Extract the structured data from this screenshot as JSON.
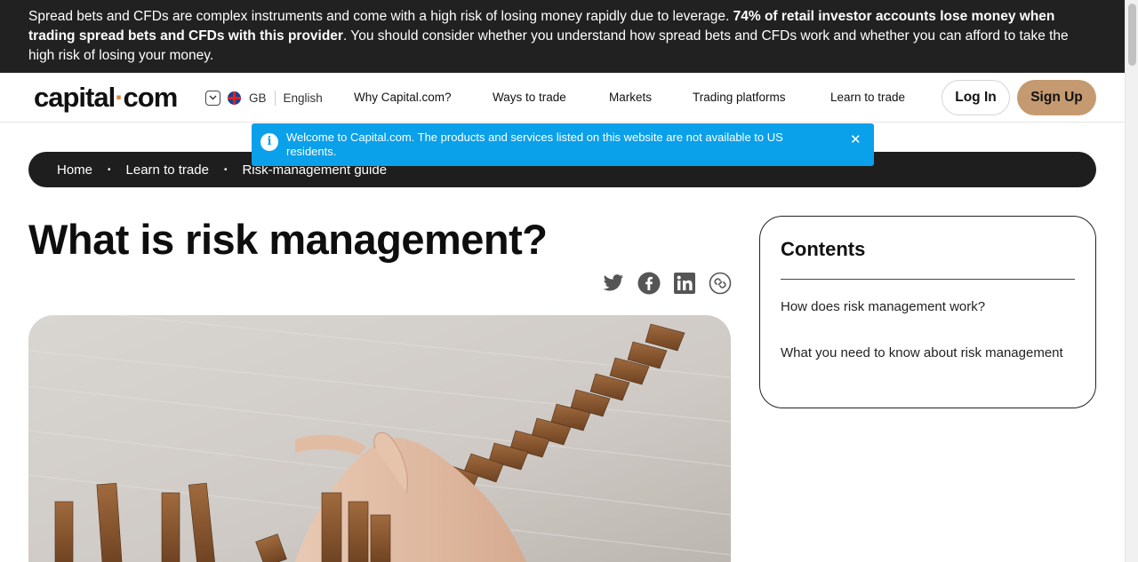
{
  "risk_banner": {
    "text_before": "Spread bets and CFDs are complex instruments and come with a high risk of losing money rapidly due to leverage. ",
    "text_bold": "74% of retail investor accounts lose money when trading spread bets and CFDs with this provider",
    "text_after": ". You should consider whether you understand how spread bets and CFDs work and whether you can afford to take the high risk of losing your money."
  },
  "header": {
    "logo_part1": "capital",
    "logo_dot": "·",
    "logo_part2": "com",
    "region_code": "GB",
    "language": "English",
    "nav": [
      "Why Capital.com?",
      "Ways to trade",
      "Markets",
      "Trading platforms",
      "Learn to trade"
    ],
    "login_label": "Log In",
    "signup_label": "Sign Up"
  },
  "toast": {
    "info_symbol": "i",
    "message": "Welcome to Capital.com. The products and services listed on this website are not available to US residents.",
    "close_symbol": "✕"
  },
  "breadcrumb": {
    "items": [
      "Home",
      "Learn to trade",
      "Risk-management guide"
    ],
    "separator": "•"
  },
  "article": {
    "title": "What is risk management?"
  },
  "contents": {
    "heading": "Contents",
    "items": [
      "How does risk management work?",
      "What you need to know about risk management"
    ]
  },
  "colors": {
    "banner_bg": "#212121",
    "accent": "#c59a70",
    "toast_bg": "#0aa0ea",
    "logo_dot": "#e0883e",
    "share_icon": "#555555"
  },
  "icons": {
    "share": [
      "twitter-icon",
      "facebook-icon",
      "linkedin-icon",
      "copy-link-icon"
    ]
  }
}
